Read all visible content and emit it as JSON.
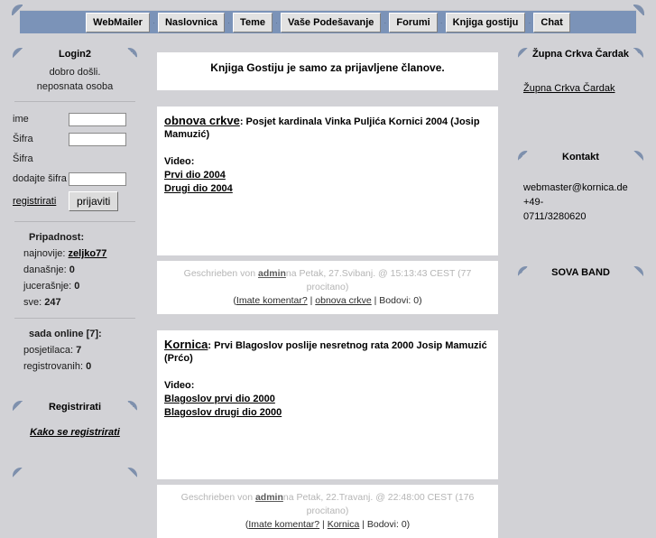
{
  "nav": {
    "separator": "·",
    "items": [
      {
        "label": "WebMailer"
      },
      {
        "label": "Naslovnica"
      },
      {
        "label": "Teme"
      },
      {
        "label": "Vaše Podešavanje"
      },
      {
        "label": "Forumi"
      },
      {
        "label": "Knjiga gostiju"
      },
      {
        "label": "Chat"
      }
    ]
  },
  "colors": {
    "page_bg": "#d2d2d6",
    "nav_bar": "#7b93b8",
    "panel": "#ffffff",
    "corner": "#7e90ad"
  },
  "sidebar_left": {
    "login": {
      "title": "Login2",
      "welcome_line1": "dobro došli.",
      "welcome_line2": "neposnata osoba",
      "fields": [
        {
          "label": "ime",
          "value": "",
          "placeholder": "",
          "has_input": true
        },
        {
          "label": "Šifra",
          "value": "",
          "placeholder": "",
          "has_input": true
        },
        {
          "label": "Šifra",
          "value": "",
          "placeholder": "",
          "has_input": false
        },
        {
          "label": "dodajte šifra",
          "value": "",
          "placeholder": "",
          "has_input": true
        }
      ],
      "register_link": "registrirati",
      "submit_button": "prijaviti",
      "membership": {
        "heading": "Pripadnost:",
        "rows": [
          {
            "label": "najnovije:",
            "value": "zeljko77",
            "is_link": true
          },
          {
            "label": "današnje:",
            "value": "0",
            "is_link": false
          },
          {
            "label": "jucerašnje:",
            "value": "0",
            "is_link": false
          },
          {
            "label": "sve:",
            "value": "247",
            "is_link": false
          }
        ]
      },
      "online": {
        "heading": "sada online [7]:",
        "rows": [
          {
            "label": "posjetilaca:",
            "value": "7"
          },
          {
            "label": "registrovanih:",
            "value": "0"
          }
        ]
      }
    },
    "register_block": {
      "title": "Registrirati",
      "link": "Kako se registrirati"
    }
  },
  "main": {
    "notice": "Knjiga Gostiju je samo za prijavljene članove.",
    "posts": [
      {
        "title_link": "obnova crkve",
        "title_rest": ": Posjet kardinala Vinka Puljića Kornici 2004 (Josip Mamuzić)",
        "body_label": "Video:",
        "links": [
          "Prvi dio 2004",
          "Drugi dio 2004"
        ],
        "footer_pre": "Geschrieben von ",
        "footer_author": "admin",
        "footer_post": "na Petak, 27.Svibanj. @ 15:13:43 CEST (77 procitano)",
        "footer_line2_open": "(",
        "footer_comment": "Imate komentar?",
        "footer_sep1": " | ",
        "footer_topic": "obnova crkve",
        "footer_sep2": " | ",
        "footer_score": "Bodovi: 0)"
      },
      {
        "title_link": "Kornica",
        "title_rest": ": Prvi Blagoslov poslije nesretnog rata 2000 Josip Mamuzić (Prćo)",
        "body_label": "Video:",
        "links": [
          "Blagoslov prvi dio 2000",
          "Blagoslov drugi dio 2000"
        ],
        "footer_pre": "Geschrieben von ",
        "footer_author": "admin",
        "footer_post": "na Petak, 22.Travanj. @ 22:48:00 CEST (176 procitano)",
        "footer_line2_open": "(",
        "footer_comment": "Imate komentar?",
        "footer_sep1": " | ",
        "footer_topic": "Kornica",
        "footer_sep2": " | ",
        "footer_score": "Bodovi: 0)"
      }
    ]
  },
  "sidebar_right": {
    "blocks": [
      {
        "title": "Župna Crkva Čardak",
        "link": "Župna Crkva Čardak",
        "lines": []
      },
      {
        "title": "Kontakt",
        "link": "",
        "lines": [
          "webmaster@kornica.de",
          "+49-",
          "0711/3280620"
        ]
      },
      {
        "title": "SOVA BAND",
        "link": "",
        "lines": []
      }
    ]
  }
}
